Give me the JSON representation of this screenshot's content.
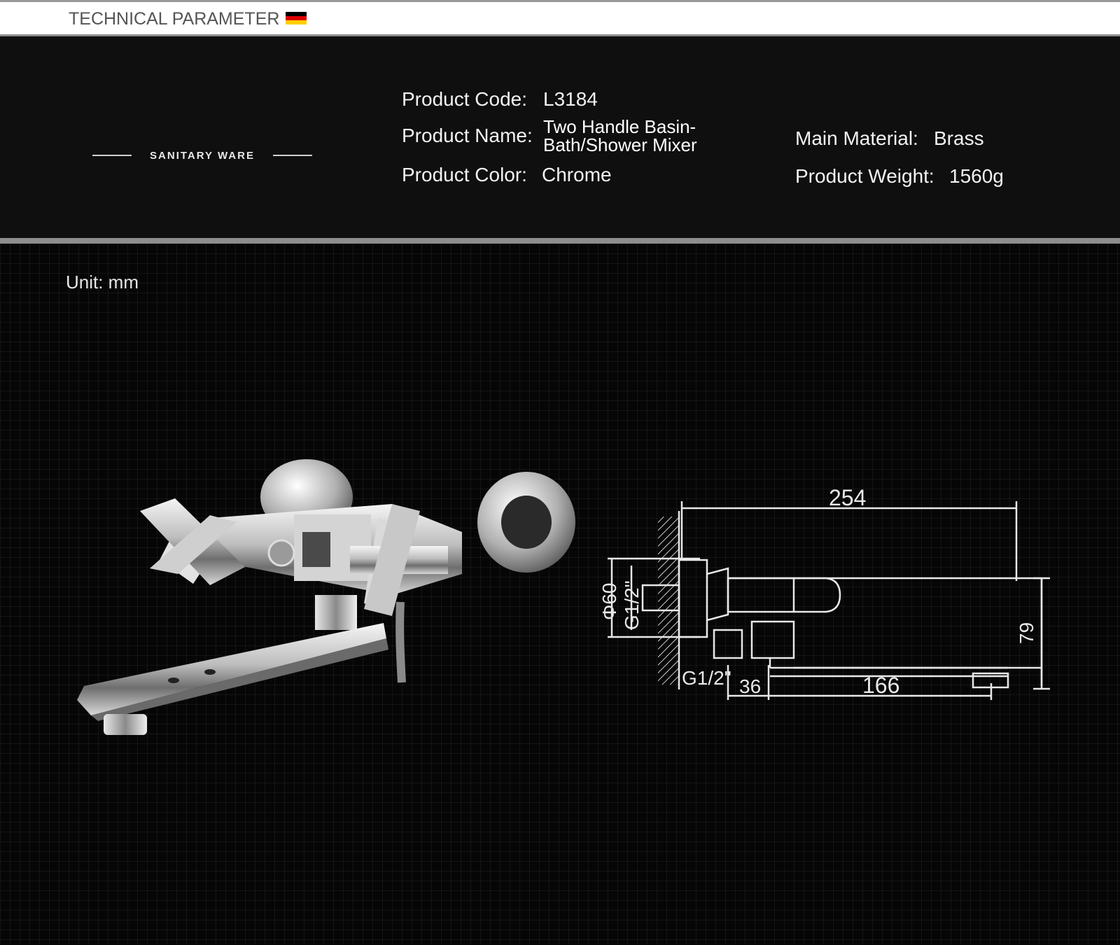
{
  "header": {
    "title": "TECHNICAL PARAMETER",
    "flag_colors": [
      "#000000",
      "#dd0000",
      "#ffce00"
    ]
  },
  "brand": {
    "label": "SANITARY WARE"
  },
  "specs": {
    "code_label": "Product Code:",
    "code_value": "L3184",
    "name_label": "Product Name:",
    "name_value_line1": "Two Handle Basin-",
    "name_value_line2": "Bath/Shower Mixer",
    "color_label": "Product Color:",
    "color_value": "Chrome",
    "material_label": "Main Material:",
    "material_value": "Brass",
    "weight_label": "Product Weight:",
    "weight_value": "1560g"
  },
  "drawing": {
    "unit_label": "Unit: mm",
    "dims": {
      "length": "254",
      "diameter": "Φ60",
      "thread_top": "G1/2\"",
      "height": "79",
      "thread_bottom": "G1/2\"",
      "offset": "36",
      "spout": "166"
    }
  },
  "colors": {
    "spec_background": "#0f0f0f",
    "drawing_background": "#060606",
    "line_color": "#e8e8e8"
  }
}
